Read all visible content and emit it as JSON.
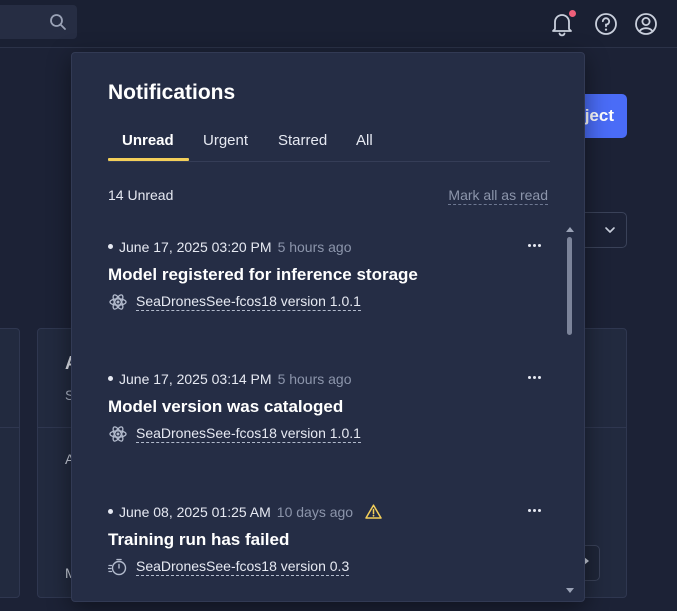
{
  "topbar": {
    "search_icon": "search-icon",
    "icons": [
      "bell-icon",
      "help-icon",
      "user-icon"
    ]
  },
  "background": {
    "primary_button_label": "ject",
    "card_letters": [
      "A",
      "S",
      "A",
      "M"
    ]
  },
  "notifications": {
    "title": "Notifications",
    "tabs": [
      {
        "label": "Unread",
        "active": true
      },
      {
        "label": "Urgent",
        "active": false
      },
      {
        "label": "Starred",
        "active": false
      },
      {
        "label": "All",
        "active": false
      }
    ],
    "unread_count": "14 Unread",
    "mark_all_label": "Mark all as read",
    "items": [
      {
        "date": "June 17, 2025 03:20 PM",
        "ago": "5 hours ago",
        "title": "Model registered for inference storage",
        "link": "SeaDronesSee-fcos18 version 1.0.1",
        "icon": "model-icon",
        "warning": false
      },
      {
        "date": "June 17, 2025 03:14 PM",
        "ago": "5 hours ago",
        "title": "Model version was cataloged",
        "link": "SeaDronesSee-fcos18 version 1.0.1",
        "icon": "model-icon",
        "warning": false
      },
      {
        "date": "June 08, 2025 01:25 AM",
        "ago": "10 days ago",
        "title": "Training run has failed",
        "link": "SeaDronesSee-fcos18 version 0.3",
        "icon": "stopwatch-icon",
        "warning": true
      }
    ]
  },
  "colors": {
    "accent_tab": "#f3cf5a",
    "badge": "#ef5f7a",
    "primary": "#4a6cf7",
    "warning": "#f3cf5a"
  }
}
